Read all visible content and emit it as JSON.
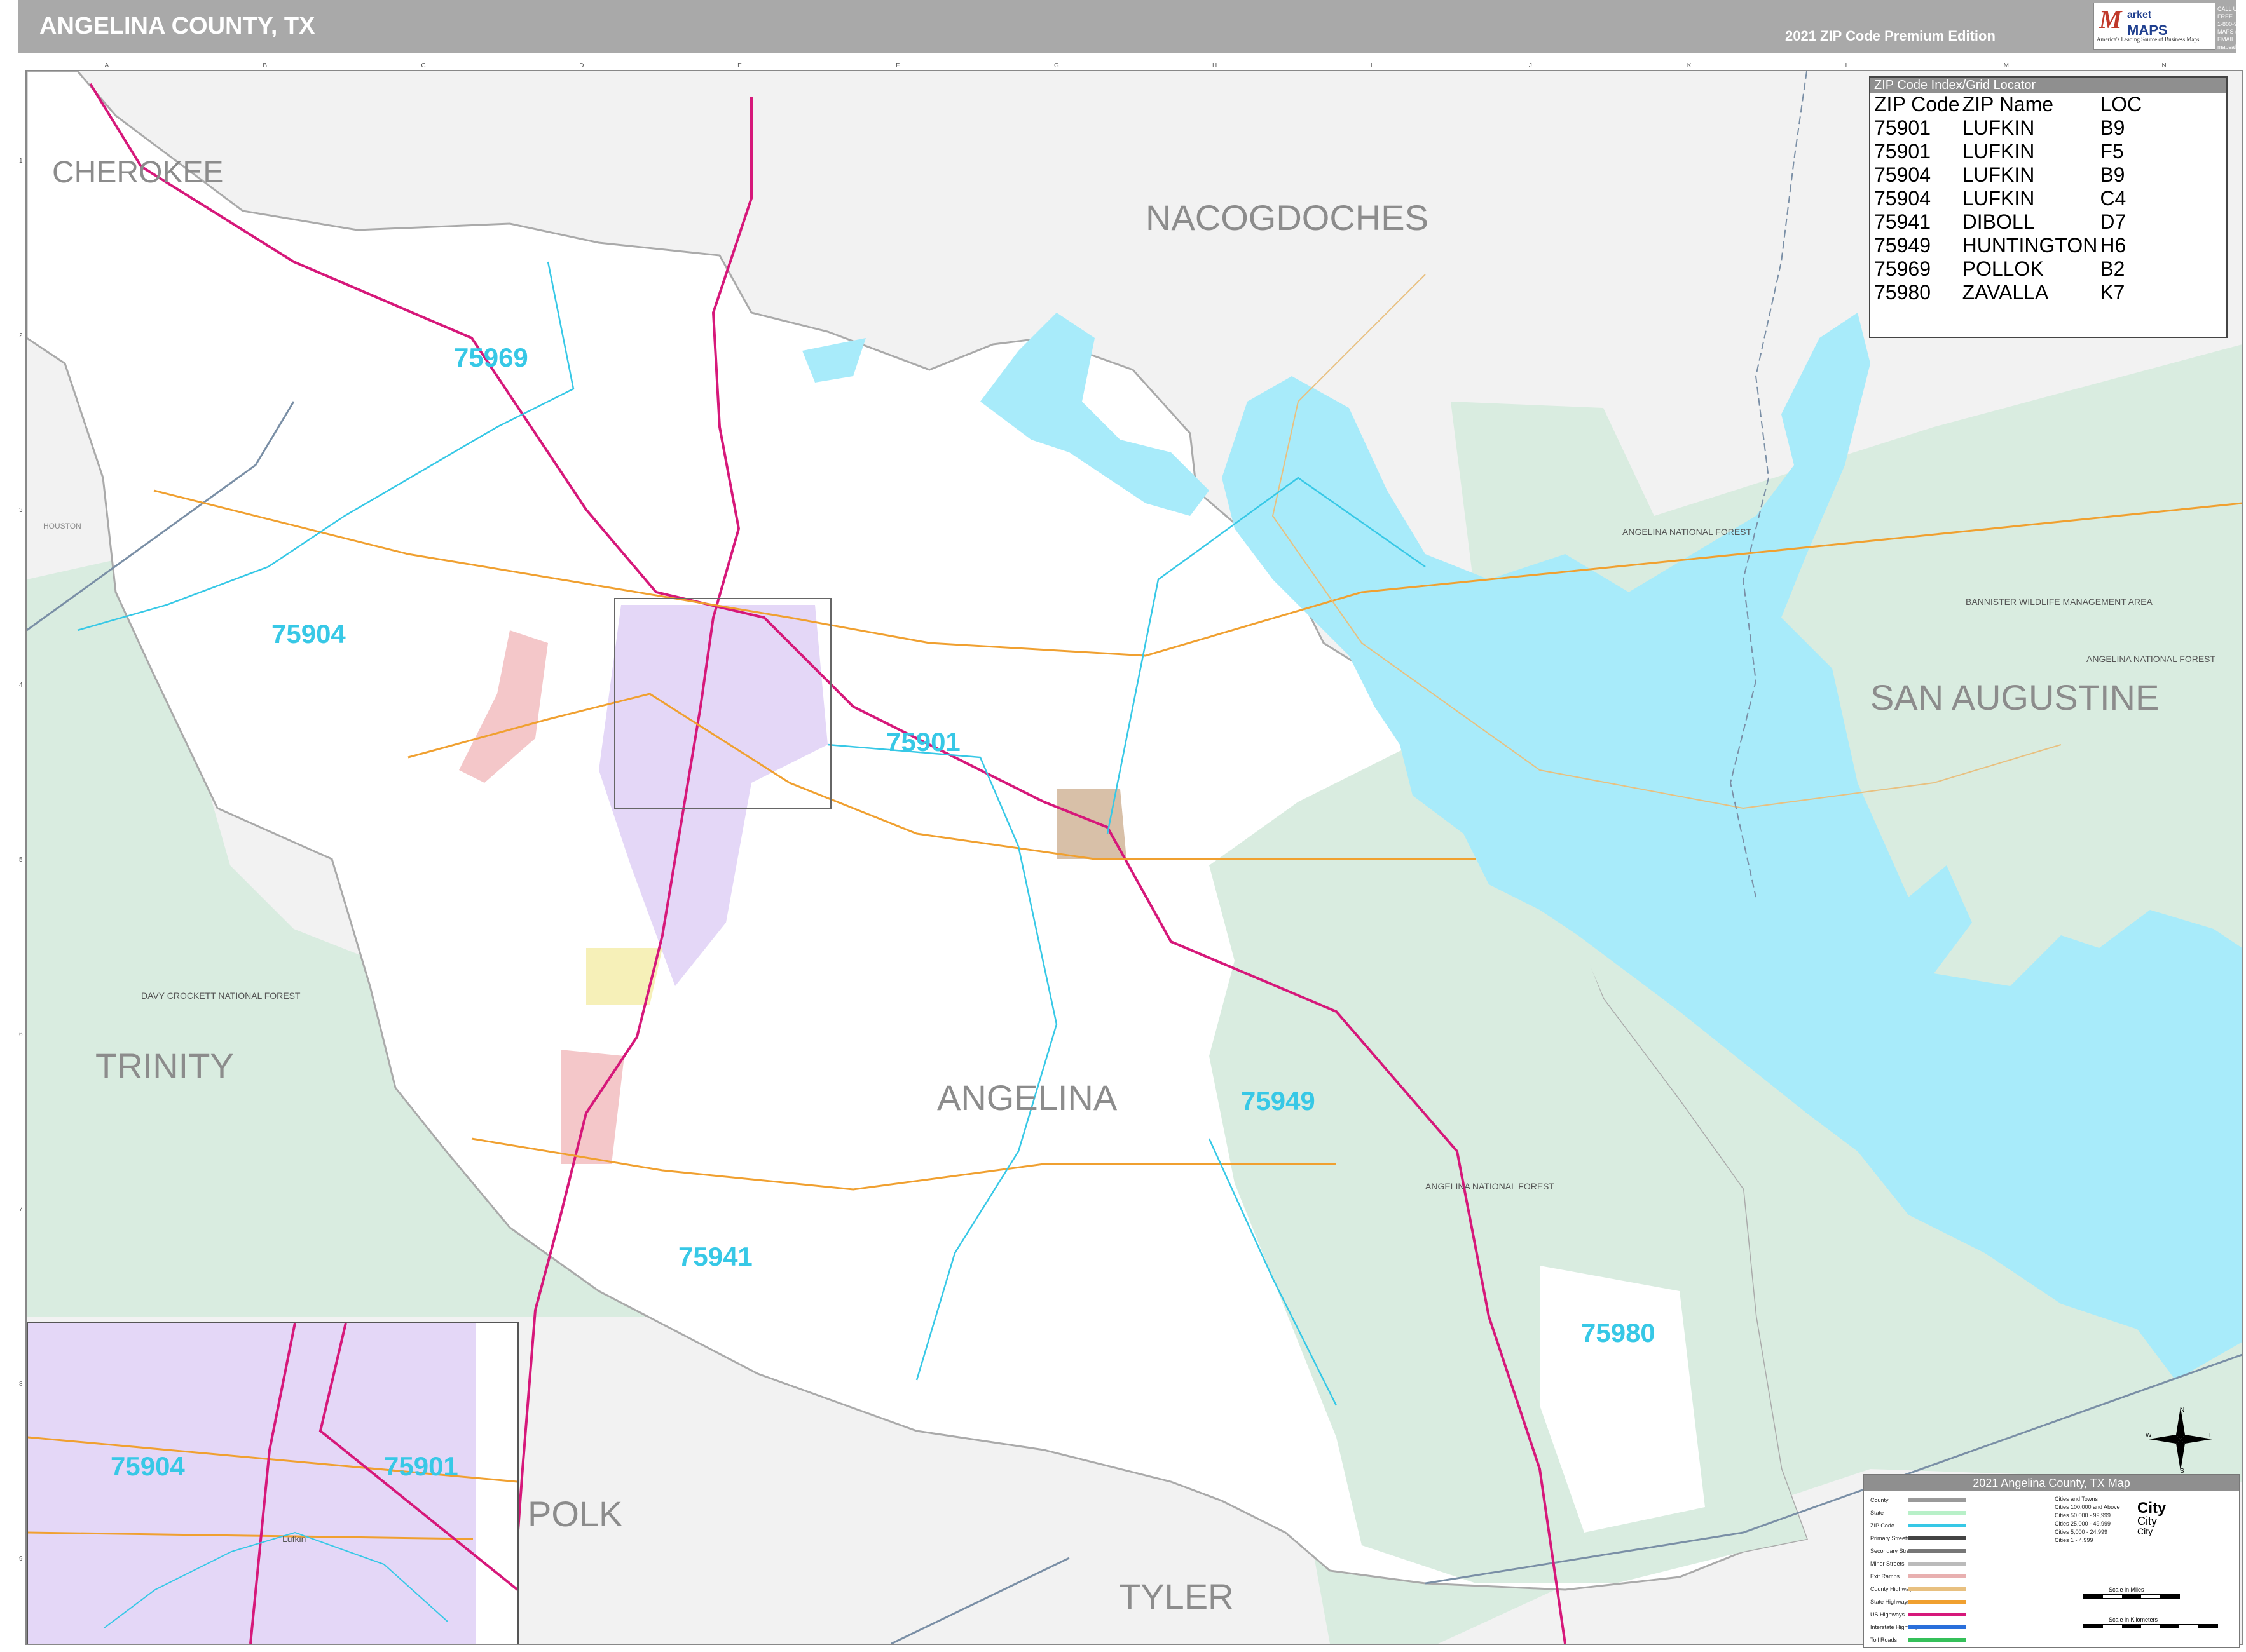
{
  "header": {
    "title": "ANGELINA COUNTY, TX",
    "edition": "2021 ZIP Code Premium Edition",
    "logo_mark": "M",
    "logo_line1": "arket",
    "logo_line2": "MAPS",
    "logo_tagline": "America's Leading Source of Business Maps",
    "contact_lines": [
      "CALL US TOLL FREE",
      "1-800-934-MAPS (6277)",
      "EMAIL US AT",
      "mapsales@marketmaps.com"
    ]
  },
  "counties": {
    "cherokee": "CHEROKEE",
    "nacogdoches": "NACOGDOCHES",
    "san_augustine": "SAN AUGUSTINE",
    "trinity": "TRINITY",
    "angelina": "ANGELINA",
    "polk": "POLK",
    "tyler": "TYLER",
    "houston": "HOUSTON"
  },
  "zip_labels": {
    "z75969": "75969",
    "z75904": "75904",
    "z75901": "75901",
    "z75949": "75949",
    "z75941": "75941",
    "z75980": "75980",
    "inset_75904": "75904",
    "inset_75901": "75901"
  },
  "area_labels": {
    "angelina_nf_north": "ANGELINA NATIONAL FOREST",
    "bannister": "BANNISTER WILDLIFE MANAGEMENT AREA",
    "angelina_nf_east": "ANGELINA NATIONAL FOREST",
    "davy_crockett": "DAVY CROCKETT NATIONAL FOREST",
    "angelina_nf_south": "ANGELINA NATIONAL FOREST",
    "inset_city": "Lufkin"
  },
  "zip_index": {
    "title": "ZIP Code Index/Grid Locator",
    "headers": [
      "ZIP Code",
      "ZIP Name",
      "LOC"
    ],
    "rows": [
      [
        "75901",
        "LUFKIN",
        "B9"
      ],
      [
        "75901",
        "LUFKIN",
        "F5"
      ],
      [
        "75904",
        "LUFKIN",
        "B9"
      ],
      [
        "75904",
        "LUFKIN",
        "C4"
      ],
      [
        "75941",
        "DIBOLL",
        "D7"
      ],
      [
        "75949",
        "HUNTINGTON",
        "H6"
      ],
      [
        "75969",
        "POLLOK",
        "B2"
      ],
      [
        "75980",
        "ZAVALLA",
        "K7"
      ]
    ]
  },
  "legend": {
    "title": "2021 Angelina County, TX Map",
    "rows": [
      "County",
      "State",
      "ZIP Code",
      "Primary Streets",
      "Secondary Streets",
      "Minor Streets",
      "Exit Ramps",
      "County Highways",
      "State Highways",
      "US Highways",
      "Interstate Highways",
      "Toll Roads"
    ],
    "city_sizes": [
      "Cities and Towns",
      "Cities 100,000 and Above",
      "Cities 50,000 - 99,999",
      "Cities 25,000 - 49,999",
      "Cities 5,000 - 24,999",
      "Cities 1 - 4,999"
    ],
    "city_word": "City",
    "scale_miles": "Scale in Miles",
    "scale_km": "Scale in Kilometers"
  },
  "compass": {
    "n": "N",
    "s": "S",
    "e": "E",
    "w": "W"
  },
  "grid": {
    "columns": [
      "A",
      "B",
      "C",
      "D",
      "E",
      "F",
      "G",
      "H",
      "I",
      "J",
      "K",
      "L",
      "M",
      "N"
    ],
    "rows": [
      "1",
      "2",
      "3",
      "4",
      "5",
      "6",
      "7",
      "8",
      "9"
    ]
  },
  "colors": {
    "water": "#a8ebfa",
    "forest": "#d9ece0",
    "county_fill": "#ffffff",
    "outside": "#f2f2f2",
    "zip_label": "#37c8e6",
    "interstate": "#d6187a",
    "city_lufkin": "#e4d7f7",
    "city_pink": "#f4c7c9",
    "city_tan": "#d8c0a8"
  }
}
